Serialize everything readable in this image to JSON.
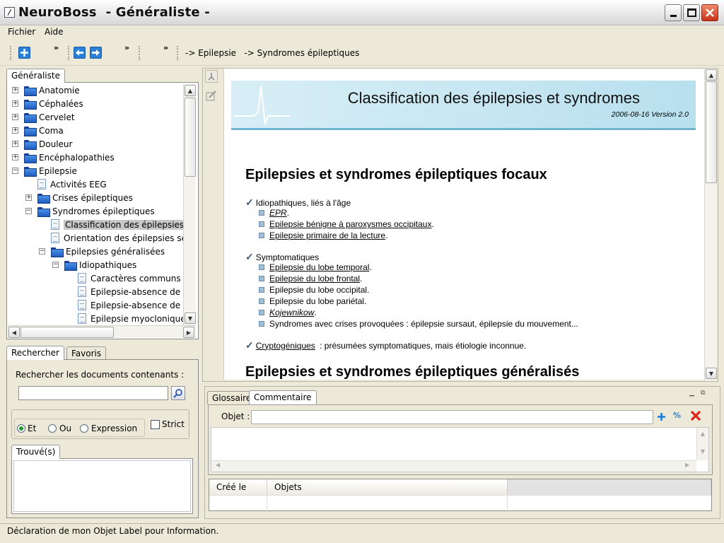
{
  "window": {
    "app_name": "NeuroBoss",
    "title": "NeuroBoss  - Généraliste -"
  },
  "menu": [
    "Fichier",
    "Aide"
  ],
  "breadcrumb": "-> Epilepsie   -> Syndromes épileptiques",
  "left_panel": {
    "tab": "Généraliste",
    "tree": [
      {
        "label": "Anatomie",
        "icon": "folder-icon",
        "expander": "+",
        "level": 0
      },
      {
        "label": "Céphalées",
        "icon": "folder-icon",
        "expander": "+",
        "level": 0
      },
      {
        "label": "Cervelet",
        "icon": "folder-icon",
        "expander": "+",
        "level": 0
      },
      {
        "label": "Coma",
        "icon": "folder-icon",
        "expander": "+",
        "level": 0
      },
      {
        "label": "Douleur",
        "icon": "folder-icon",
        "expander": "+",
        "level": 0
      },
      {
        "label": "Encéphalopathies",
        "icon": "folder-icon",
        "expander": "+",
        "level": 0
      },
      {
        "label": "Epilepsie",
        "icon": "folder-open-icon",
        "expander": "−",
        "level": 0
      },
      {
        "label": "Activités EEG",
        "icon": "document-icon",
        "expander": "",
        "level": 1
      },
      {
        "label": "Crises épileptiques",
        "icon": "folder-icon",
        "expander": "+",
        "level": 1
      },
      {
        "label": "Syndromes épileptiques",
        "icon": "folder-open-icon",
        "expander": "−",
        "level": 1
      },
      {
        "label": "Classification des épilepsies e",
        "icon": "document-icon",
        "expander": "",
        "level": 2,
        "selected": true
      },
      {
        "label": "Orientation des épilepsies se",
        "icon": "document-icon",
        "expander": "",
        "level": 2
      },
      {
        "label": "Epilepsies généralisées",
        "icon": "folder-open-icon",
        "expander": "−",
        "level": 2
      },
      {
        "label": "Idiopathiques",
        "icon": "folder-open-icon",
        "expander": "−",
        "level": 3
      },
      {
        "label": "Caractères communs c",
        "icon": "document-icon",
        "expander": "",
        "level": 4
      },
      {
        "label": "Epilepsie-absence de l",
        "icon": "document-icon",
        "expander": "",
        "level": 4
      },
      {
        "label": "Epilepsie-absence de l",
        "icon": "document-icon",
        "expander": "",
        "level": 4
      },
      {
        "label": "Epilepsie myoclonique",
        "icon": "document-icon",
        "expander": "",
        "level": 4
      }
    ]
  },
  "search_panel": {
    "tabs": [
      "Rechercher",
      "Favoris"
    ],
    "label": "Rechercher les documents contenants :",
    "input_value": "",
    "radios": [
      {
        "label": "Et",
        "checked": true
      },
      {
        "label": "Ou",
        "checked": false
      },
      {
        "label": "Expression",
        "checked": false
      }
    ],
    "strict_label": "Strict",
    "strict_checked": false,
    "results_tab": "Trouvé(s)"
  },
  "document": {
    "title": "Classification des épilepsies et syndromes",
    "subtitle": "2006-08-16 Version 2.0",
    "section1": "Epilepsies et syndromes épileptiques focaux",
    "group1": {
      "label": "Idiopathiques, liés à l'âge",
      "items": [
        {
          "text": "EPR",
          "suffix": ".",
          "style": "ui"
        },
        {
          "text": "Epilepsie bénigne à paroxysmes occipitaux",
          "suffix": ".",
          "style": "u"
        },
        {
          "text": "Epilepsie primaire de la lecture",
          "suffix": ".",
          "style": "u"
        }
      ]
    },
    "group2": {
      "label": "Symptomatiques",
      "items": [
        {
          "text": "Epilepsie du lobe temporal",
          "suffix": ".",
          "style": "u"
        },
        {
          "text": "Epilepsie du lobe frontal",
          "suffix": ".",
          "style": "u"
        },
        {
          "text": "Epilepsie du lobe occipital.",
          "suffix": "",
          "style": ""
        },
        {
          "text": "Epilepsie du lobe pariétal.",
          "suffix": "",
          "style": ""
        },
        {
          "text": "Kojewnikow",
          "suffix": ".",
          "style": "ui"
        },
        {
          "text": "Syndromes avec crises provoquées : épilepsie sursaut, épilepsie du mouvement...",
          "suffix": "",
          "style": ""
        }
      ]
    },
    "group3": {
      "label": "Cryptogéniques",
      "rest": " : présumées symptomatiques, mais étiologie inconnue."
    },
    "section2": "Epilepsies et syndromes épileptiques généralisés"
  },
  "bottom_panel": {
    "tabs": [
      "Glossaire",
      "Commentaire"
    ],
    "objet_label": "Objet :",
    "objet_value": "",
    "columns": [
      "Créé le",
      "Objets"
    ]
  },
  "status": "Déclaration de mon Objet Label pour Information.",
  "colors": {
    "accent": "#1f5cc0",
    "banner": "#b8e0ee",
    "close": "#c8321a"
  }
}
